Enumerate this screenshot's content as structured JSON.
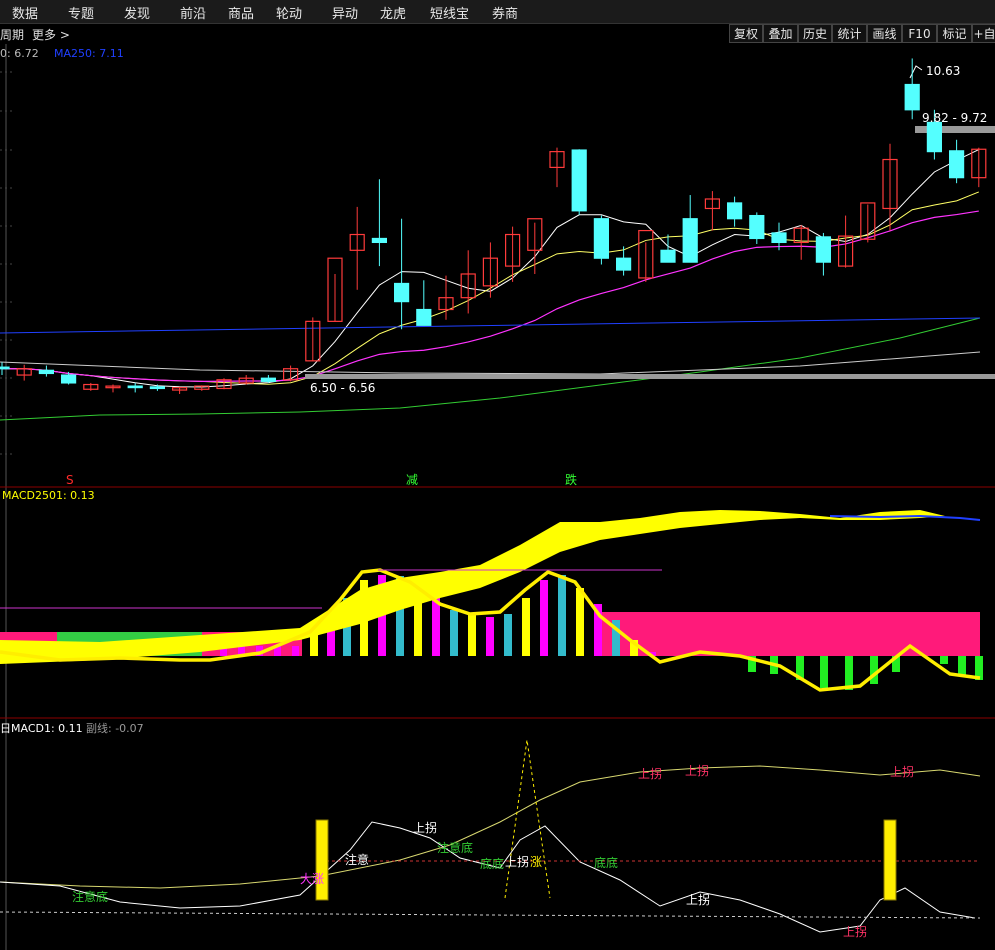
{
  "nav": {
    "items": [
      "数据",
      "专题",
      "发现",
      "前沿",
      "商品",
      "轮动",
      "异动",
      "龙虎",
      "短线宝",
      "券商"
    ]
  },
  "toolbar": {
    "period_label": "周期",
    "more_label": "更多 >",
    "buttons": [
      "复权",
      "叠加",
      "历史",
      "统计",
      "画线",
      "F10",
      "标记",
      "+自"
    ]
  },
  "main_panel": {
    "legend_ma": "0: 6.72",
    "legend_ma250": "MA250: 7.11",
    "high_label": "10.63",
    "resist_label": "9.82 - 9.72",
    "support_label": "6.50 - 6.56",
    "signal_s": "S",
    "signal_jian": "减",
    "signal_die": "跌"
  },
  "macd_panel": {
    "title": "MACD2501: 0.13"
  },
  "lower_panel": {
    "title": "日MACD1: 0.11",
    "sub_label": "副线: -0.07",
    "annotations": [
      "注意底",
      "大涨",
      "注意",
      "上拐",
      "注意底",
      "底底",
      "上拐",
      "涨",
      "底底",
      "上拐",
      "上拐",
      "上拐",
      "上拐",
      "上拐"
    ]
  },
  "colors": {
    "up": "#ff3b3b",
    "down": "#54ffff",
    "ma_white": "#ffffff",
    "ma_yellow": "#ffff66",
    "ma_magenta": "#ff33ff",
    "ma_green": "#33cc33",
    "ma_blue": "#2040ff",
    "macd_yellow": "#ffff00",
    "macd_pink": "#ff1a7a",
    "macd_green": "#33cc44"
  },
  "chart_data": {
    "type": "candlestick",
    "ohlc": [
      [
        6.72,
        6.78,
        6.62,
        6.7
      ],
      [
        6.62,
        6.75,
        6.55,
        6.7
      ],
      [
        6.68,
        6.74,
        6.6,
        6.64
      ],
      [
        6.62,
        6.66,
        6.5,
        6.52
      ],
      [
        6.44,
        6.52,
        6.42,
        6.5
      ],
      [
        6.46,
        6.5,
        6.4,
        6.48
      ],
      [
        6.48,
        6.52,
        6.4,
        6.47
      ],
      [
        6.47,
        6.5,
        6.42,
        6.45
      ],
      [
        6.43,
        6.47,
        6.38,
        6.46
      ],
      [
        6.44,
        6.49,
        6.42,
        6.48
      ],
      [
        6.45,
        6.58,
        6.44,
        6.56
      ],
      [
        6.52,
        6.62,
        6.5,
        6.58
      ],
      [
        6.58,
        6.62,
        6.52,
        6.54
      ],
      [
        6.56,
        6.74,
        6.54,
        6.7
      ],
      [
        6.8,
        7.35,
        6.8,
        7.3
      ],
      [
        7.3,
        7.9,
        7.3,
        8.1
      ],
      [
        8.2,
        8.75,
        7.7,
        8.4
      ],
      [
        8.35,
        9.1,
        8.0,
        8.3
      ],
      [
        7.78,
        8.6,
        7.2,
        7.55
      ],
      [
        7.45,
        7.82,
        7.3,
        7.25
      ],
      [
        7.45,
        7.88,
        7.32,
        7.6
      ],
      [
        7.6,
        8.2,
        7.4,
        7.9
      ],
      [
        7.75,
        8.3,
        7.6,
        8.1
      ],
      [
        8.0,
        8.5,
        7.8,
        8.4
      ],
      [
        8.2,
        8.55,
        7.9,
        8.6
      ],
      [
        9.25,
        9.5,
        9.0,
        9.45
      ],
      [
        9.47,
        9.48,
        8.65,
        8.7
      ],
      [
        8.6,
        8.64,
        8.02,
        8.1
      ],
      [
        8.1,
        8.25,
        7.88,
        7.95
      ],
      [
        7.85,
        8.3,
        7.8,
        8.45
      ],
      [
        8.2,
        8.4,
        8.1,
        8.05
      ],
      [
        8.6,
        8.9,
        8.2,
        8.05
      ],
      [
        8.73,
        8.95,
        8.45,
        8.85
      ],
      [
        8.8,
        8.88,
        8.5,
        8.6
      ],
      [
        8.64,
        8.68,
        8.28,
        8.35
      ],
      [
        8.42,
        8.55,
        8.2,
        8.3
      ],
      [
        8.3,
        8.52,
        8.08,
        8.48
      ],
      [
        8.37,
        8.42,
        7.88,
        8.05
      ],
      [
        8.0,
        8.64,
        7.98,
        8.38
      ],
      [
        8.34,
        8.78,
        8.3,
        8.8
      ],
      [
        8.73,
        9.55,
        8.45,
        9.35
      ],
      [
        10.3,
        10.63,
        9.86,
        9.98
      ],
      [
        9.82,
        9.98,
        9.35,
        9.45
      ],
      [
        9.46,
        9.6,
        9.05,
        9.12
      ],
      [
        9.12,
        9.5,
        9.0,
        9.48
      ]
    ],
    "annotations": [
      "10.63",
      "9.82 - 9.72",
      "6.50 - 6.56"
    ]
  }
}
